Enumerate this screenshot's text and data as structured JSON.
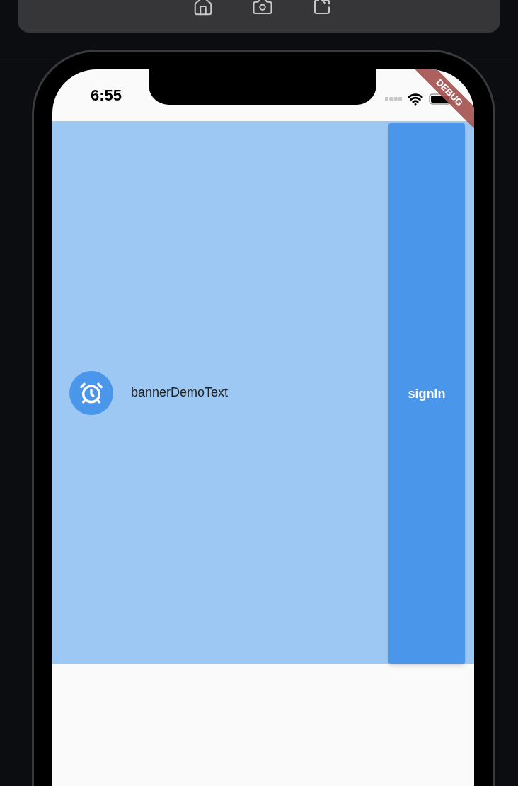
{
  "status_bar": {
    "time": "6:55"
  },
  "debug_banner": {
    "label": "DEBUG"
  },
  "banner": {
    "text": "bannerDemoText",
    "action": "signIn"
  }
}
